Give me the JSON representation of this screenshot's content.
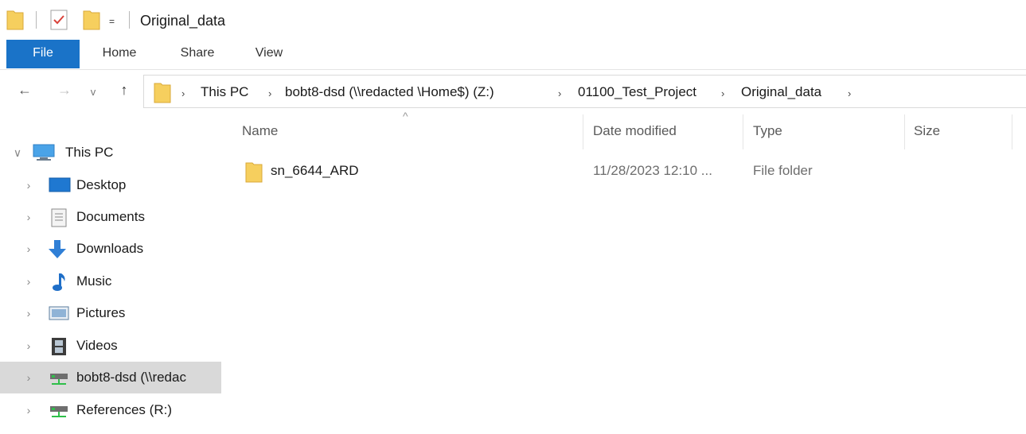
{
  "window": {
    "title": "Original_data",
    "quick_access_dropdown": "="
  },
  "ribbon": {
    "tabs": [
      {
        "label": "File",
        "active": true
      },
      {
        "label": "Home"
      },
      {
        "label": "Share"
      },
      {
        "label": "View"
      }
    ]
  },
  "navigation": {
    "back_icon": "←",
    "forward_icon": "→",
    "recent_icon": "v",
    "up_icon": "↑"
  },
  "address": {
    "separator": "›",
    "crumbs": [
      "This PC",
      "bobt8-dsd (\\\\redacted \\Home$) (Z:)",
      "01100_Test_Project",
      "Original_data"
    ]
  },
  "nav_pane": {
    "items": [
      {
        "label": "This PC",
        "icon": "computer-icon",
        "expanded": true
      },
      {
        "label": "Desktop",
        "icon": "desktop-icon"
      },
      {
        "label": "Documents",
        "icon": "documents-icon"
      },
      {
        "label": "Downloads",
        "icon": "downloads-icon"
      },
      {
        "label": "Music",
        "icon": "music-icon"
      },
      {
        "label": "Pictures",
        "icon": "pictures-icon"
      },
      {
        "label": "Videos",
        "icon": "videos-icon"
      },
      {
        "label": "bobt8-dsd (\\\\redac",
        "icon": "network-drive-icon",
        "selected": true
      },
      {
        "label": "References (R:)",
        "icon": "network-drive-icon"
      }
    ],
    "expanded_arrow": "∨",
    "collapsed_arrow": "›"
  },
  "file_list": {
    "sort_indicator": "^",
    "columns": [
      "Name",
      "Date modified",
      "Type",
      "Size"
    ],
    "rows": [
      {
        "name": "sn_6644_ARD",
        "date_modified": "11/28/2023 12:10 ...",
        "type": "File folder",
        "size": ""
      }
    ]
  },
  "colors": {
    "file_tab": "#1a73c8",
    "folder_yellow": "#f6cf5e",
    "selected_row": "#d9d9d9"
  }
}
